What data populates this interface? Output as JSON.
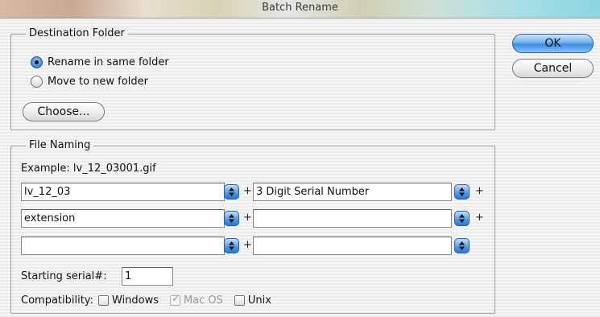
{
  "window": {
    "title": "Batch Rename"
  },
  "destination": {
    "legend": "Destination Folder",
    "options": [
      {
        "label": "Rename in same folder",
        "selected": true
      },
      {
        "label": "Move to new folder",
        "selected": false
      }
    ],
    "choose_label": "Choose..."
  },
  "buttons": {
    "ok": "OK",
    "cancel": "Cancel"
  },
  "file_naming": {
    "legend": "File Naming",
    "example": "Example: lv_12_03001.gif",
    "rows": [
      {
        "left": "lv_12_03",
        "right": "3 Digit Serial Number"
      },
      {
        "left": "extension",
        "right": ""
      },
      {
        "left": "",
        "right": ""
      }
    ],
    "plus_symbol": "+",
    "starting_serial_label": "Starting serial#:",
    "starting_serial_value": "1",
    "compatibility_label": "Compatibility:",
    "compatibility": [
      {
        "label": "Windows",
        "checked": false,
        "disabled": false
      },
      {
        "label": "Mac OS",
        "checked": true,
        "disabled": true
      },
      {
        "label": "Unix",
        "checked": false,
        "disabled": false
      }
    ]
  },
  "colors": {
    "accent": "#3b8be0",
    "title_text": "#3a3a3a"
  },
  "icons": {
    "stepper": "up-down-arrows-icon",
    "radio": "radio-button",
    "checkbox": "checkbox"
  }
}
